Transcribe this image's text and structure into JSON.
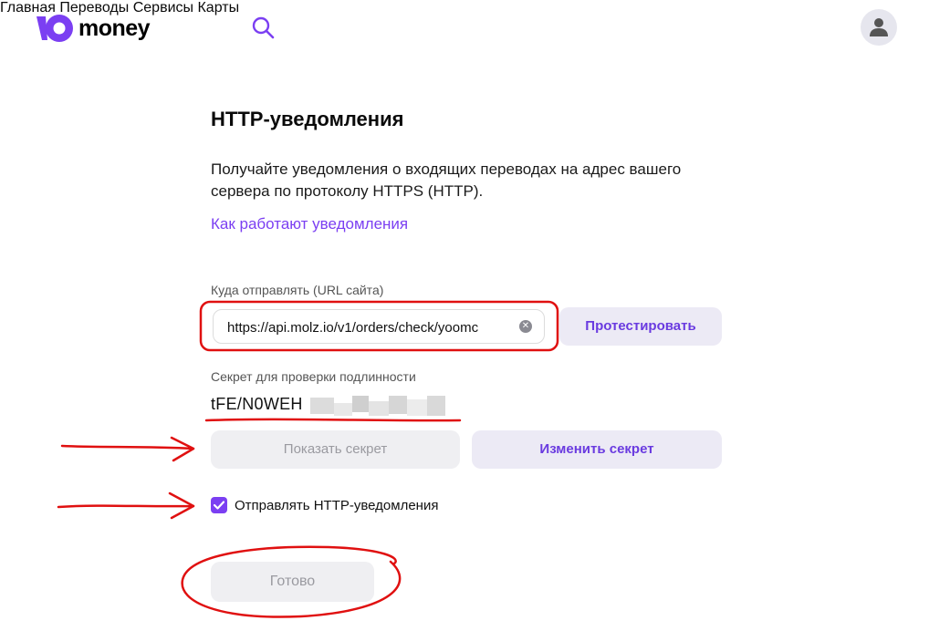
{
  "header": {
    "logo_text": "money",
    "nav": [
      {
        "label": "Главная"
      },
      {
        "label": "Переводы"
      },
      {
        "label": "Сервисы"
      },
      {
        "label": "Карты"
      }
    ]
  },
  "main": {
    "title": "HTTP-уведомления",
    "description": "Получайте уведомления о входящих переводах на адрес вашего сервера по протоколу HTTPS (HTTP).",
    "help_link": "Как работают уведомления",
    "url_label": "Куда отправлять (URL сайта)",
    "url_value": "https://api.molz.io/v1/orders/check/yoomc",
    "test_button": "Протестировать",
    "secret_label": "Секрет для проверки подлинности",
    "secret_visible": "tFE/N0WEH",
    "show_secret_button": "Показать секрет",
    "change_secret_button": "Изменить секрет",
    "send_checkbox_label": "Отправлять HTTP-уведомления",
    "send_checkbox_checked": true,
    "done_button": "Готово"
  },
  "colors": {
    "brand_purple": "#7b3ff2",
    "annotation_red": "#e01010"
  }
}
